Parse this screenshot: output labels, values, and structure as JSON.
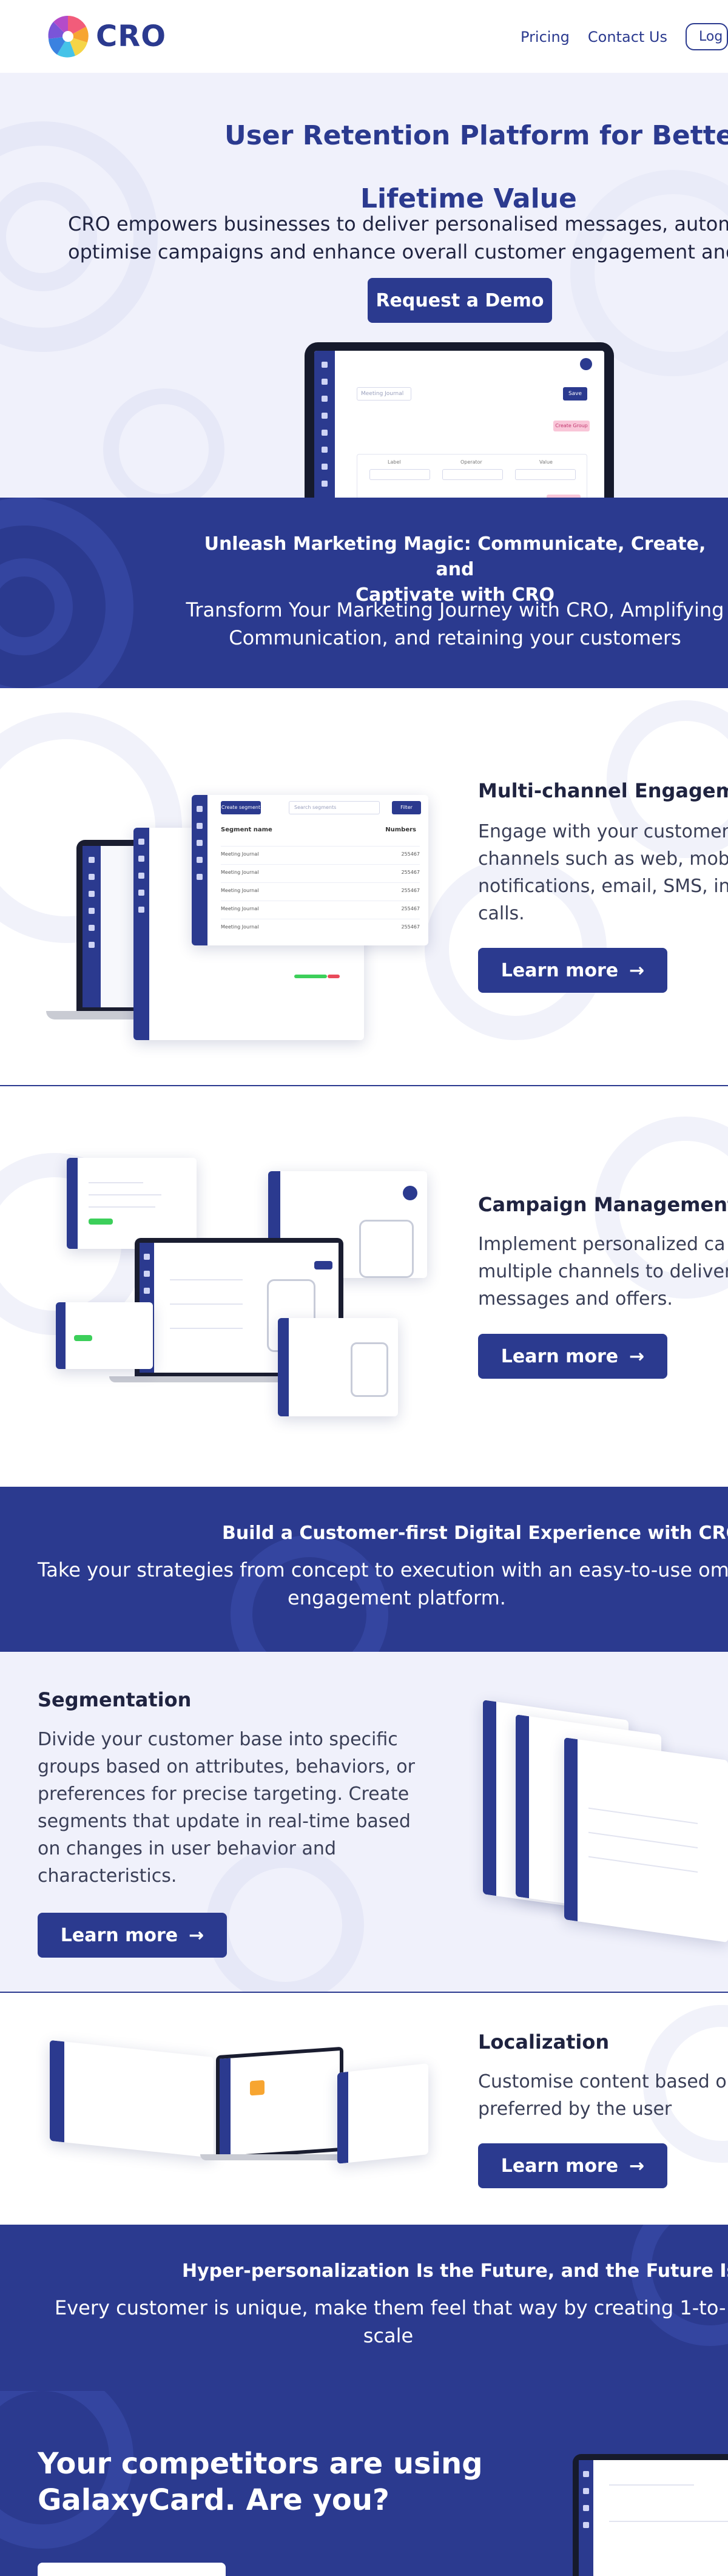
{
  "header": {
    "brand": "CRO",
    "nav": [
      "Pricing",
      "Contact Us"
    ],
    "login": "Log"
  },
  "hero": {
    "title_line1": "User Retention Platform for Better",
    "title_line2": "Lifetime Value",
    "subtitle_line1": "CRO empowers businesses to deliver personalised messages, automate",
    "subtitle_line2": "optimise campaigns and enhance overall customer engagement and",
    "cta": "Request a Demo",
    "mock_search": "Meeting Journal",
    "mock_button": "Save",
    "mock_tag": "Create Group",
    "mock_col1": "Label",
    "mock_col2": "Operator",
    "mock_col3": "Value"
  },
  "banner1": {
    "title_line1": "Unleash Marketing Magic: Communicate, Create, and",
    "title_line2": "Captivate with CRO",
    "text_line1": "Transform Your Marketing Journey with CRO, Amplifying",
    "text_line2": "Communication, and retaining your customers"
  },
  "multichannel": {
    "title": "Multi-channel Engagemen",
    "desc_line1": "Engage with your customer",
    "desc_line2": "channels such as web, mob",
    "desc_line3": "notifications, email, SMS, in-",
    "desc_line4": "calls.",
    "cta": "Learn more",
    "mock_header_btn": "Create segment",
    "mock_search": "Search segments",
    "mock_filter": "Filter",
    "mock_col_name": "Segment name",
    "mock_col_numbers": "Numbers",
    "mock_rows": [
      {
        "name": "Meeting Journal",
        "value": "255467"
      },
      {
        "name": "Meeting Journal",
        "value": "255467"
      },
      {
        "name": "Meeting Journal",
        "value": "255467"
      },
      {
        "name": "Meeting Journal",
        "value": "255467"
      },
      {
        "name": "Meeting Journal",
        "value": "255467"
      }
    ]
  },
  "campaign": {
    "title": "Campaign Management",
    "desc_line1": "Implement personalized ca",
    "desc_line2": "multiple channels to deliver",
    "desc_line3": "messages and offers.",
    "cta": "Learn more"
  },
  "banner2": {
    "title": "Build a Customer-first Digital Experience with CRO",
    "text_line1": "Take your strategies from concept to execution with an easy-to-use omnic",
    "text_line2": "engagement platform."
  },
  "segmentation": {
    "title": "Segmentation",
    "desc_line1": "Divide your customer base into specific",
    "desc_line2": "groups based on attributes, behaviors, or",
    "desc_line3": "preferences for precise targeting. Create",
    "desc_line4": "segments that update in real-time based",
    "desc_line5": "on changes in user behavior and",
    "desc_line6": "characteristics.",
    "cta": "Learn more"
  },
  "localization": {
    "title": "Localization",
    "desc_line1": "Customise content based o",
    "desc_line2": "preferred by the user",
    "cta": "Learn more"
  },
  "banner3": {
    "title": "Hyper-personalization Is the Future, and the Future Is Now",
    "text_line1": "Every customer is unique, make them feel that way by creating 1-to-1 con",
    "text_line2": "scale"
  },
  "bottom": {
    "title_line1": "Your competitors are using",
    "title_line2": "GalaxyCard. Are you?"
  },
  "colors": {
    "brand": "#2b3a8f",
    "light_bg": "#f0f1fb",
    "accent_pink": "#f07aa8",
    "accent_green": "#3ccf5a"
  },
  "icons": [
    "logo-mark-icon",
    "arrow-right-icon"
  ]
}
